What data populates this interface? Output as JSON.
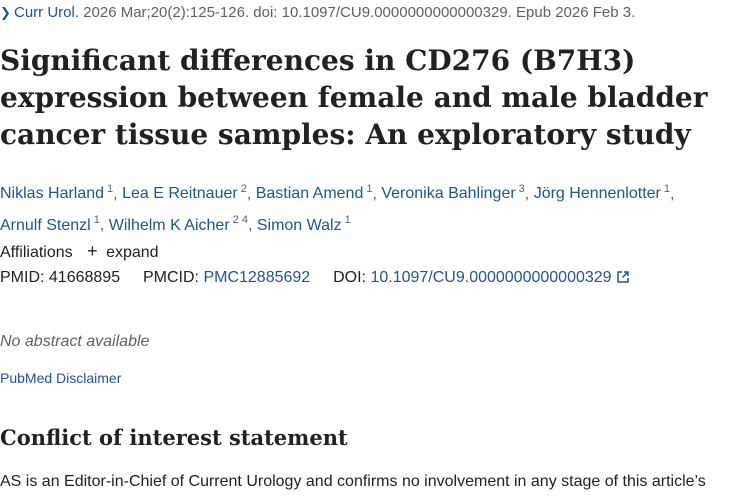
{
  "citation": {
    "journal": "Curr Urol.",
    "details": " 2026 Mar;20(2):125-126. doi: 10.1097/CU9.0000000000000329. Epub 2026 Feb 3."
  },
  "title": "Significant differences in CD276 (B7H3) expression between female and male bladder cancer tissue samples: An exploratory study",
  "authors": [
    {
      "name": "Niklas Harland",
      "aff": "1"
    },
    {
      "name": "Lea E Reitnauer",
      "aff": "2"
    },
    {
      "name": "Bastian Amend",
      "aff": "1"
    },
    {
      "name": "Veronika Bahlinger",
      "aff": "3"
    },
    {
      "name": "Jörg Hennenlotter",
      "aff": "1"
    },
    {
      "name": "Arnulf Stenzl",
      "aff": "1"
    },
    {
      "name": "Wilhelm K Aicher",
      "aff": "2 4"
    },
    {
      "name": "Simon Walz",
      "aff": "1"
    }
  ],
  "affiliations": {
    "label": "Affiliations",
    "toggle": "expand"
  },
  "ids": {
    "pmid_label": "PMID:",
    "pmid": "41668895",
    "pmcid_label": "PMCID:",
    "pmcid": "PMC12885692",
    "doi_label": "DOI:",
    "doi": "10.1097/CU9.0000000000000329"
  },
  "abstract_note": "No abstract available",
  "disclaimer": "PubMed Disclaimer",
  "coi": {
    "heading": "Conflict of interest statement",
    "text": "AS is an Editor-in-Chief of Current Urology and confirms no involvement in any stage of this article’s"
  },
  "colors": {
    "link": "#205493",
    "text": "#212121",
    "muted": "#5b616b"
  }
}
